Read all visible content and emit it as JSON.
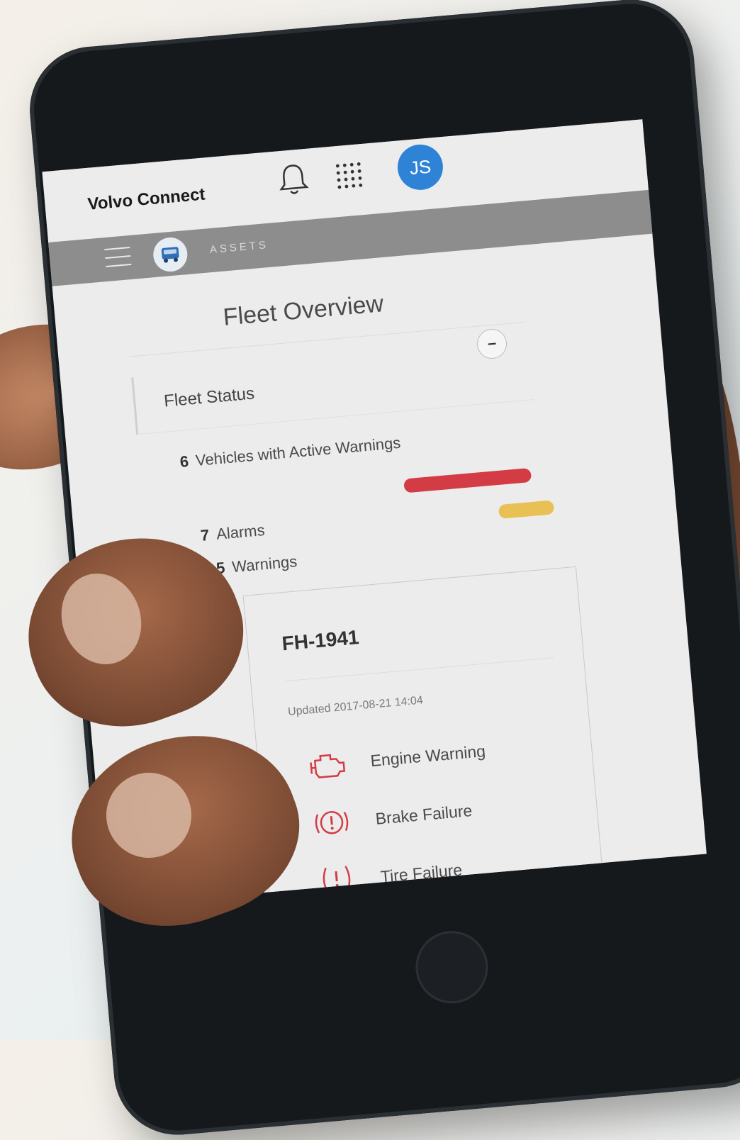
{
  "app": {
    "title": "Volvo Connect",
    "avatar_initials": "JS"
  },
  "nav": {
    "section_label": "ASSETS"
  },
  "page": {
    "title": "Fleet Overview"
  },
  "fleet_status": {
    "label": "Fleet Status",
    "collapse_symbol": "–",
    "vehicles_with_warnings_count": "6",
    "vehicles_with_warnings_label": "Vehicles with Active Warnings",
    "alarms_count": "7",
    "alarms_label": "Alarms",
    "warnings_count": "5",
    "warnings_label": "Warnings",
    "alarm_color": "#d33c45",
    "warning_color": "#e9c053"
  },
  "vehicle_card": {
    "vehicle_id": "FH-1941",
    "updated": "Updated 2017-08-21 14:04",
    "alerts": [
      {
        "label": "Engine Warning",
        "icon": "engine-icon"
      },
      {
        "label": "Brake Failure",
        "icon": "brake-icon"
      },
      {
        "label": "Tire Failure",
        "icon": "tire-pressure-icon"
      }
    ]
  },
  "colors": {
    "accent_blue": "#2f83d6",
    "nav_gray": "#8d8d8d",
    "alert_red": "#d33c45"
  }
}
